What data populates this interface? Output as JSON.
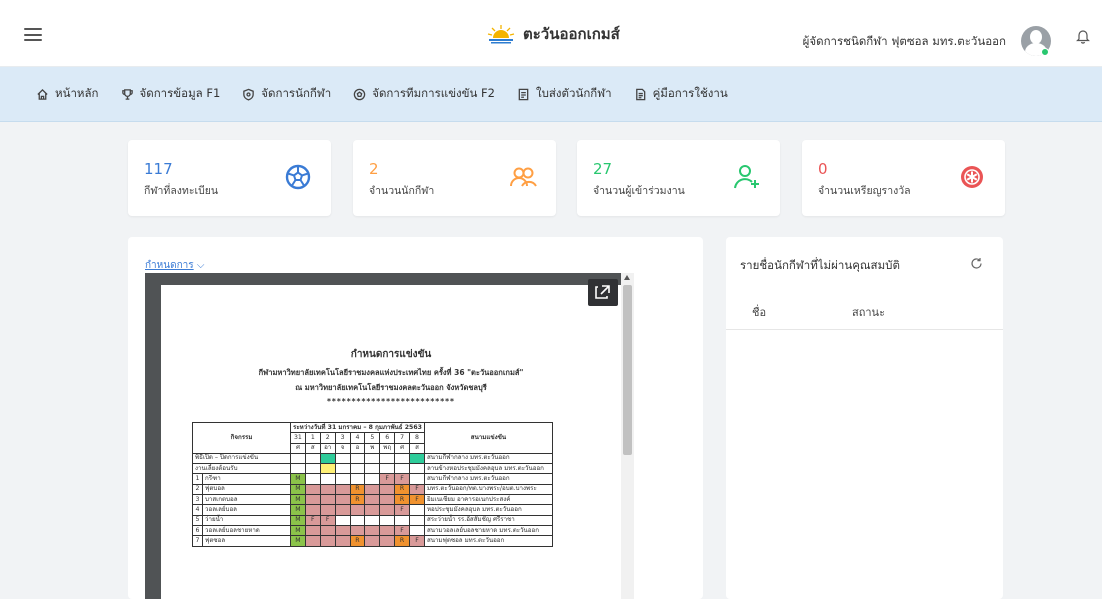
{
  "header": {
    "brand": "ตะวันออกเกมส์",
    "user_name": "ผู้จัดการชนิดกีฬา ฟุตซอล มทร.ตะวันออก"
  },
  "nav": [
    {
      "label": "หน้าหลัก",
      "icon": "home-icon"
    },
    {
      "label": "จัดการข้อมูล F1",
      "icon": "trophy-icon"
    },
    {
      "label": "จัดการนักกีฬา",
      "icon": "shield-icon"
    },
    {
      "label": "จัดการทีมการแข่งขัน F2",
      "icon": "ball-icon"
    },
    {
      "label": "ใบส่งตัวนักกีฬา",
      "icon": "document-icon"
    },
    {
      "label": "คู่มือการใช้งาน",
      "icon": "manual-icon"
    }
  ],
  "stats": [
    {
      "value": "117",
      "label": "กีฬาที่ลงทะเบียน",
      "color": "#3a7bd5",
      "icon": "football-icon"
    },
    {
      "value": "2",
      "label": "จำนวนนักกีฬา",
      "color": "#ff9f43",
      "icon": "users-icon"
    },
    {
      "value": "27",
      "label": "จำนวนผู้เข้าร่วมงาน",
      "color": "#28c76f",
      "icon": "user-plus-icon"
    },
    {
      "value": "0",
      "label": "จำนวนเหรียญรางวัล",
      "color": "#ea5455",
      "icon": "medal-icon"
    }
  ],
  "schedule": {
    "dropdown_label": "กำหนดการ",
    "doc_title": "กำหนดการแข่งขัน",
    "doc_subtitle": "กีฬามหาวิทยาลัยเทคโนโลยีราชมงคลแห่งประเทศไทย ครั้งที่ 36 \"ตะวันออกเกมส์\"",
    "doc_venue": "ณ มหาวิทยาลัยเทคโนโลยีราชมงคลตะวันออก จังหวัดชลบุรี",
    "doc_stars": "**************************",
    "table": {
      "col_activity": "กิจกรรม",
      "col_period": "ระหว่างวันที่ 31 มกราคม – 8 กุมภาพันธ์ 2563",
      "col_venue": "สนามแข่งขัน",
      "dates": [
        "31",
        "1",
        "2",
        "3",
        "4",
        "5",
        "6",
        "7",
        "8"
      ],
      "days": [
        "ศ",
        "ส",
        "อา",
        "จ",
        "อ",
        "พ",
        "พฤ",
        "ศ",
        "ส"
      ],
      "rows": [
        {
          "no": "",
          "name": "พิธีเปิด – ปิดการแข่งขัน",
          "cells": [
            "",
            "",
            "gr",
            "",
            "",
            "",
            "",
            "",
            "gr"
          ],
          "venue": "สนามกีฬากลาง มทร.ตะวันออก"
        },
        {
          "no": "",
          "name": "งานเลี้ยงต้อนรับ",
          "cells": [
            "",
            "",
            "y",
            "",
            "",
            "",
            "",
            "",
            ""
          ],
          "venue": "ลานข้างหอประชุมมังคลอุบล มทร.ตะวันออก"
        },
        {
          "no": "1",
          "name": "กรีฑา",
          "cells": [
            "M",
            "",
            "",
            "",
            "",
            "",
            "F",
            "F",
            ""
          ],
          "venue": "สนามกีฬากลาง มทร.ตะวันออก"
        },
        {
          "no": "2",
          "name": "ฟุตบอล",
          "cells": [
            "M",
            "p",
            "p",
            "p",
            "R",
            "p",
            "p",
            "R",
            "F"
          ],
          "venue": "มทร.ตะวันออก/ทต.บางพระ/อบต.บางพระ"
        },
        {
          "no": "3",
          "name": "บาสเกตบอล",
          "cells": [
            "M",
            "p",
            "p",
            "p",
            "R",
            "p",
            "p",
            "R",
            "F"
          ],
          "venue": "ยิมเนเซียม อาคารอเนกประสงค์"
        },
        {
          "no": "4",
          "name": "วอลเลย์บอล",
          "cells": [
            "M",
            "p",
            "p",
            "p",
            "p",
            "p",
            "p",
            "F",
            ""
          ],
          "venue": "หอประชุมมังคลอุบล มทร.ตะวันออก"
        },
        {
          "no": "5",
          "name": "ว่ายน้ำ",
          "cells": [
            "M",
            "F",
            "F",
            "",
            "",
            "",
            "",
            "",
            ""
          ],
          "venue": "สระว่ายน้ำ รร.อัสสัมชัญ ศรีราชา"
        },
        {
          "no": "6",
          "name": "วอลเลย์บอลชายหาด",
          "cells": [
            "M",
            "p",
            "p",
            "p",
            "p",
            "p",
            "p",
            "F",
            ""
          ],
          "venue": "สนามวอลเลย์บอลชายหาด มทร.ตะวันออก"
        },
        {
          "no": "7",
          "name": "ฟุตซอล",
          "cells": [
            "M",
            "p",
            "p",
            "p",
            "R",
            "p",
            "p",
            "R",
            "F"
          ],
          "venue": "สนามฟุตซอล มทร.ตะวันออก"
        }
      ]
    }
  },
  "ineligible": {
    "title": "รายชื่อนักกีฬาที่ไม่ผ่านคุณสมบัติ",
    "col_name": "ชื่อ",
    "col_status": "สถานะ"
  },
  "colors": {
    "accent": "#3a7bd5",
    "nav_bg": "#dbeaf7",
    "green_cell": "#8bc34a",
    "pink_cell": "#d99a99",
    "orange_cell": "#f0922f"
  }
}
